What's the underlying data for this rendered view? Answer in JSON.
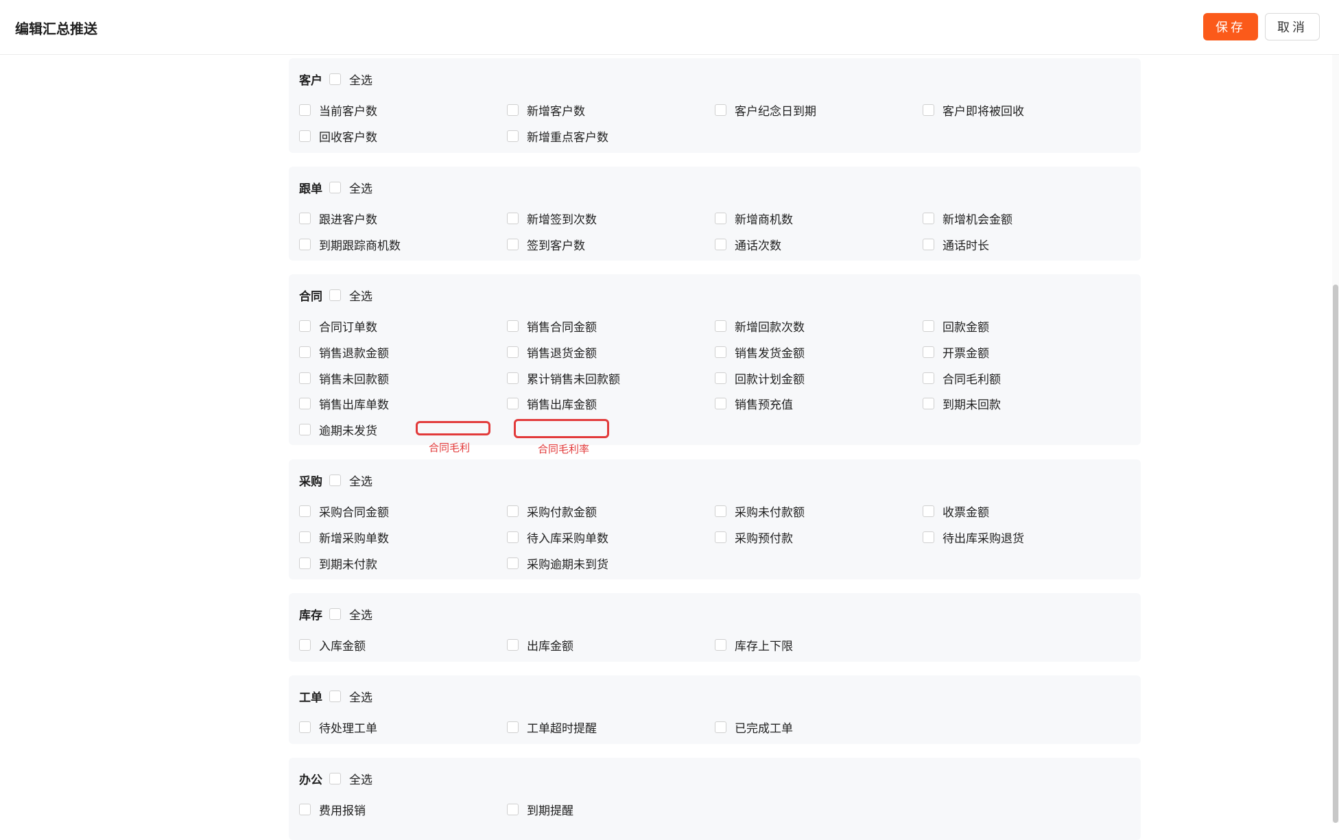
{
  "header": {
    "title": "编辑汇总推送",
    "save_label": "保存",
    "cancel_label": "取消"
  },
  "select_all_label": "全选",
  "sections": [
    {
      "title": "客户",
      "items": [
        "当前客户数",
        "新增客户数",
        "客户纪念日到期",
        "客户即将被回收",
        "回收客户数",
        "新增重点客户数"
      ]
    },
    {
      "title": "跟单",
      "items": [
        "跟进客户数",
        "新增签到次数",
        "新增商机数",
        "新增机会金额",
        "到期跟踪商机数",
        "签到客户数",
        "通话次数",
        "通话时长"
      ]
    },
    {
      "title": "合同",
      "items": [
        "合同订单数",
        "销售合同金额",
        "新增回款次数",
        "回款金额",
        "销售退款金额",
        "销售退货金额",
        "销售发货金额",
        "开票金额",
        "销售未回款额",
        "累计销售未回款额",
        "回款计划金额",
        "合同毛利额",
        "销售出库单数",
        "销售出库金额",
        "销售预充值",
        "到期未回款",
        "逾期未发货"
      ]
    },
    {
      "title": "采购",
      "items": [
        "采购合同金额",
        "采购付款金额",
        "采购未付款额",
        "收票金额",
        "新增采购单数",
        "待入库采购单数",
        "采购预付款",
        "待出库采购退货",
        "到期未付款",
        "采购逾期未到货"
      ]
    },
    {
      "title": "库存",
      "items": [
        "入库金额",
        "出库金额",
        "库存上下限"
      ]
    },
    {
      "title": "工单",
      "items": [
        "待处理工单",
        "工单超时提醒",
        "已完成工单"
      ]
    },
    {
      "title": "办公",
      "items": [
        "费用报销",
        "到期提醒"
      ]
    }
  ],
  "annotations": [
    {
      "label": "合同毛利"
    },
    {
      "label": "合同毛利率"
    }
  ],
  "colors": {
    "accent": "#fb5a1a",
    "annotation": "#e23a3a",
    "section_bg": "#f7f8fa"
  }
}
